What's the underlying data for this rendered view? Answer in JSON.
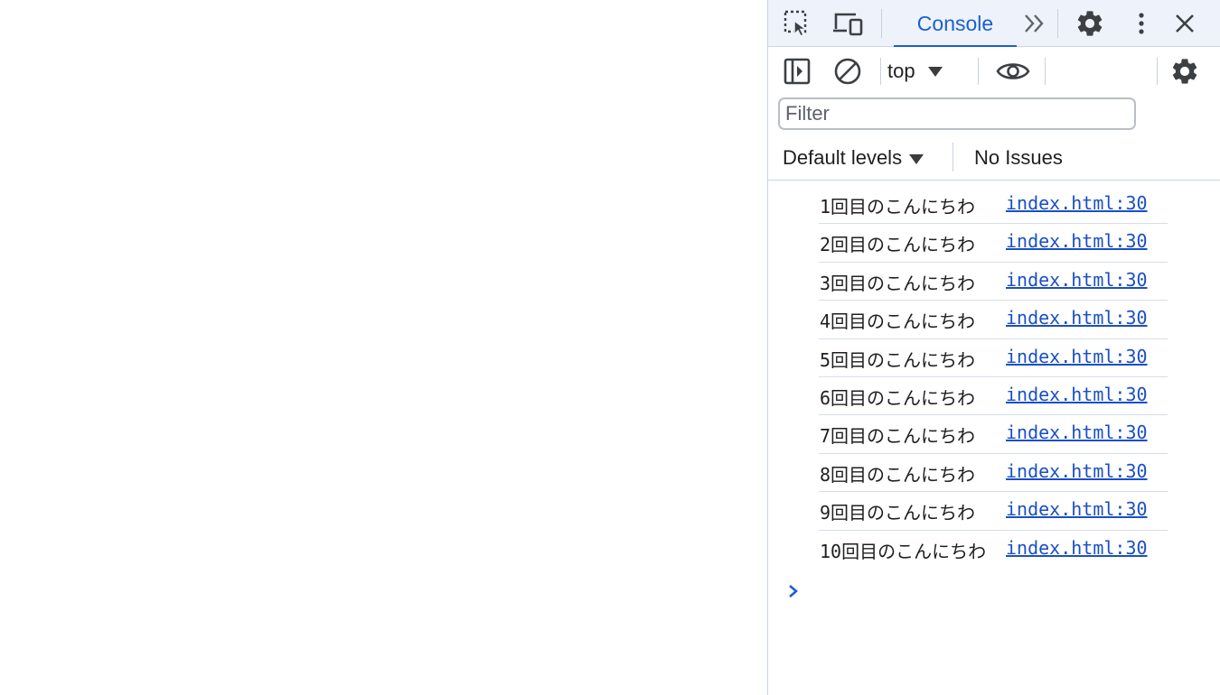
{
  "devtools": {
    "tabs": {
      "active_label": "Console"
    },
    "toolbar": {
      "context_label": "top"
    },
    "filter": {
      "placeholder": "Filter",
      "value": ""
    },
    "levels": {
      "label": "Default levels",
      "issues_label": "No Issues"
    },
    "messages": [
      {
        "text": "1回目のこんにちわ",
        "source": "index.html:30"
      },
      {
        "text": "2回目のこんにちわ",
        "source": "index.html:30"
      },
      {
        "text": "3回目のこんにちわ",
        "source": "index.html:30"
      },
      {
        "text": "4回目のこんにちわ",
        "source": "index.html:30"
      },
      {
        "text": "5回目のこんにちわ",
        "source": "index.html:30"
      },
      {
        "text": "6回目のこんにちわ",
        "source": "index.html:30"
      },
      {
        "text": "7回目のこんにちわ",
        "source": "index.html:30"
      },
      {
        "text": "8回目のこんにちわ",
        "source": "index.html:30"
      },
      {
        "text": "9回目のこんにちわ",
        "source": "index.html:30"
      },
      {
        "text": "10回目のこんにちわ",
        "source": "index.html:30"
      }
    ],
    "icons": {
      "inspect": "inspect-element-icon",
      "device": "device-toolbar-icon",
      "more_tabs": "chevron-double-right-icon",
      "settings": "gear-icon",
      "menu": "kebab-menu-icon",
      "close": "close-icon",
      "sidebar": "sidebar-toggle-icon",
      "clear": "clear-console-icon",
      "eye": "eye-icon",
      "console_settings": "gear-icon",
      "prompt": "chevron-right-icon"
    },
    "colors": {
      "accent": "#1a5fd1",
      "link": "#1a4fc4",
      "tabbar_bg": "#eef2fa"
    }
  }
}
